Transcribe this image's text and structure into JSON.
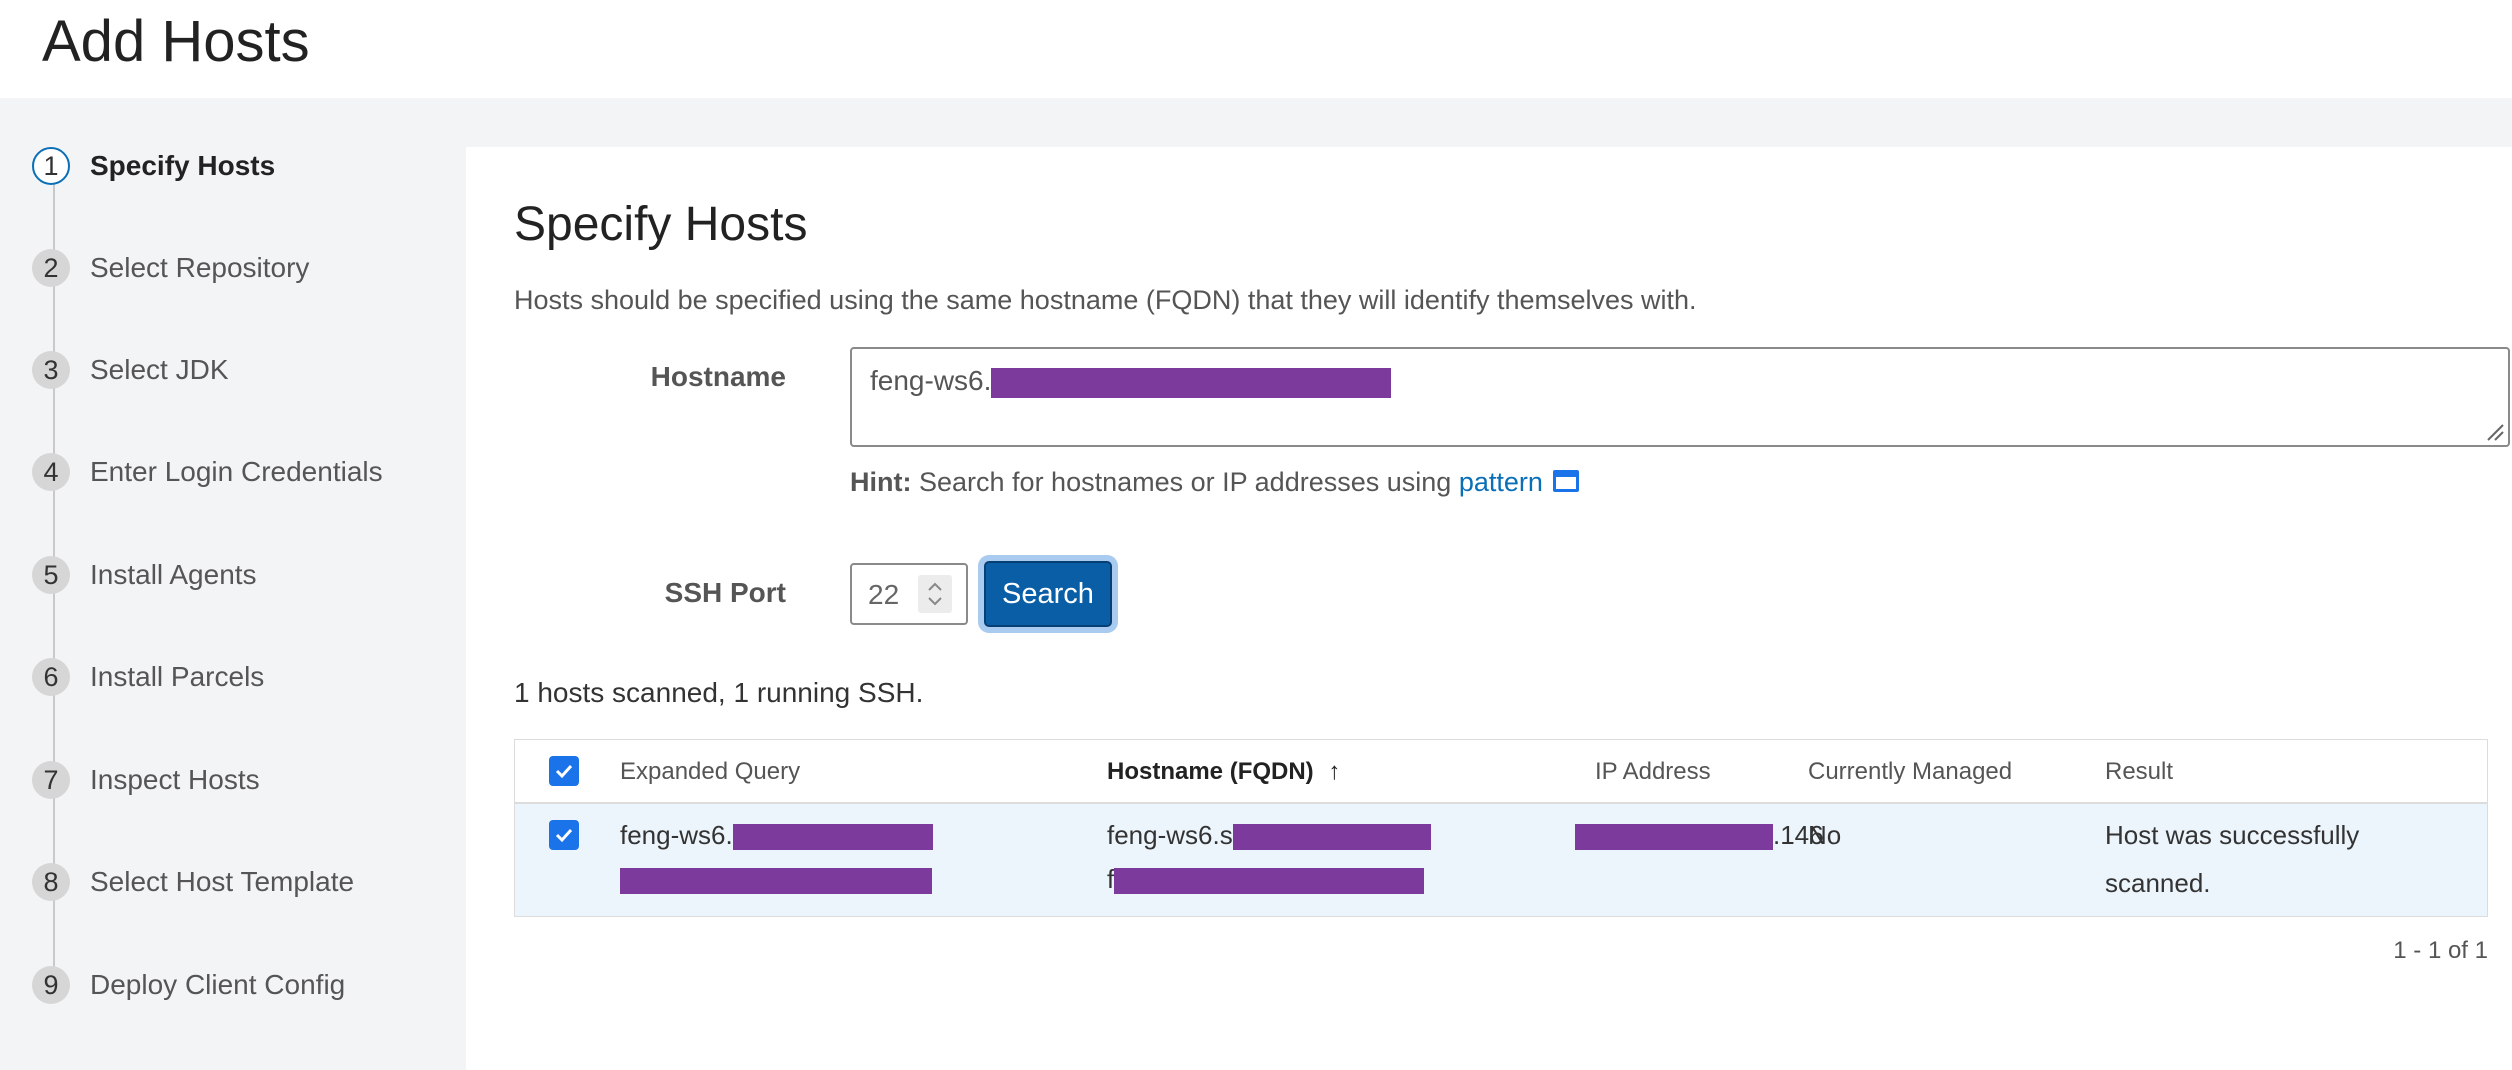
{
  "header": {
    "title": "Add Hosts"
  },
  "steps": [
    {
      "num": "1",
      "label": "Specify Hosts",
      "active": true
    },
    {
      "num": "2",
      "label": "Select Repository"
    },
    {
      "num": "3",
      "label": "Select JDK"
    },
    {
      "num": "4",
      "label": "Enter Login Credentials"
    },
    {
      "num": "5",
      "label": "Install Agents"
    },
    {
      "num": "6",
      "label": "Install Parcels"
    },
    {
      "num": "7",
      "label": "Inspect Hosts"
    },
    {
      "num": "8",
      "label": "Select Host Template"
    },
    {
      "num": "9",
      "label": "Deploy Client Config"
    }
  ],
  "main": {
    "title": "Specify Hosts",
    "description": "Hosts should be specified using the same hostname (FQDN) that they will identify themselves with.",
    "hostname_label": "Hostname",
    "hostname_value": "feng-ws6.",
    "hint_label": "Hint:",
    "hint_text": "Search for hostnames or IP addresses using",
    "hint_link": "pattern",
    "ssh_port_label": "SSH Port",
    "ssh_port_value": "22",
    "search_button": "Search",
    "scan_status": "1 hosts scanned, 1 running SSH."
  },
  "table": {
    "columns": [
      "Expanded Query",
      "Hostname (FQDN)",
      "IP Address",
      "Currently Managed",
      "Result"
    ],
    "sort_indicator": "↑",
    "rows": [
      {
        "expanded_query": "feng-ws6.",
        "hostname": "feng-ws6.s",
        "hostname_line2": "f",
        "ip_suffix": ".146",
        "managed": "No",
        "result_line1": "Host was successfully",
        "result_line2": "scanned."
      }
    ],
    "pager": "1 - 1 of 1"
  },
  "colors": {
    "accent": "#0a5ea6",
    "redaction": "#7b3a9c",
    "row_selected": "#edf5fc"
  }
}
